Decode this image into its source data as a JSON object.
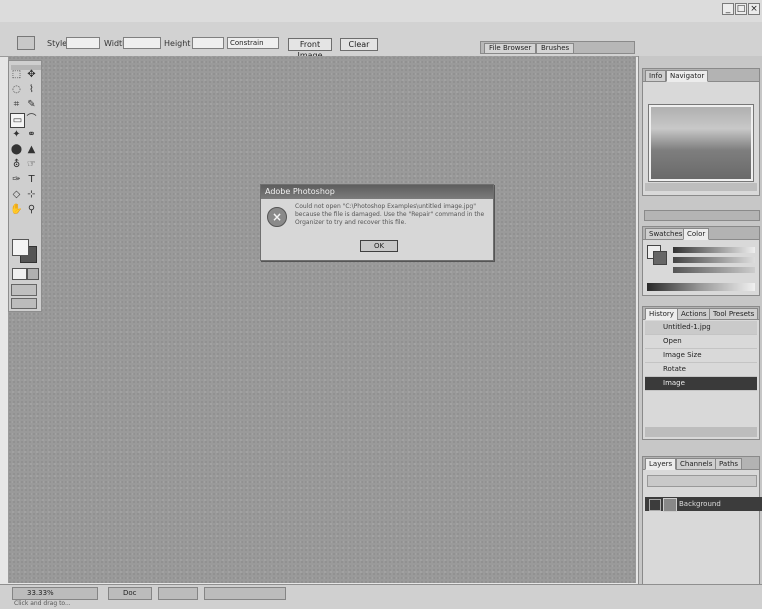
{
  "window": {
    "minimize": "_",
    "maximize": "□",
    "close": "×"
  },
  "options_bar": {
    "icon": "marquee-tool-icon",
    "feather_label": "Style",
    "width_label": "Width",
    "height_label": "Height",
    "dropdown_value": "Constrain",
    "front_button": "Front Image",
    "clear_button": "Clear",
    "well_tabs": [
      "File Browser",
      "Brushes"
    ]
  },
  "tools": [
    "⬚",
    "✥",
    "◌",
    "⌇",
    "⌗",
    "✎",
    "▭",
    "⌒",
    "✦",
    "⚭",
    "⬤",
    "▲",
    "⛢",
    "☞",
    "✑",
    "T",
    "◇",
    "⊹",
    "✋",
    "⚲"
  ],
  "right_panels": {
    "navigator": {
      "tabs": [
        "Info",
        "Navigator"
      ]
    },
    "color": {
      "tabs": [
        "Swatches",
        "Color"
      ]
    },
    "history": {
      "tabs": [
        "History",
        "Actions",
        "Tool Presets"
      ],
      "snapshot": "Untitled-1.jpg",
      "items": [
        "Open",
        "Image Size",
        "Rotate",
        "Image"
      ],
      "selected": 3
    },
    "layers": {
      "tabs": [
        "Layers",
        "Channels",
        "Paths"
      ],
      "layer_name": "Background"
    }
  },
  "statusbar": {
    "items": [
      "33.33%",
      "Doc",
      "",
      ""
    ],
    "status_text": "Click and drag to..."
  },
  "dialog": {
    "title": "Adobe Photoshop",
    "message": "Could not open \"C:\\Photoshop Examples\\untitled image.jpg\" because the file is damaged. Use the \"Repair\" command in the Organizer to try and recover this file.",
    "ok": "OK"
  },
  "colors": {
    "canvas": "#9a9a9a",
    "dialog_title": "#5d5d5d"
  }
}
